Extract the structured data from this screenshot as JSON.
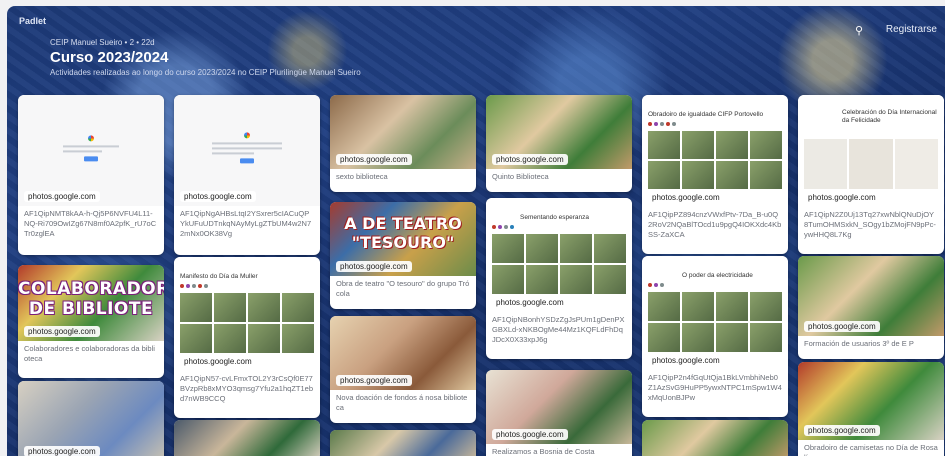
{
  "app": {
    "logo": "Padlet",
    "register_label": "Registrarse"
  },
  "header": {
    "meta": "CEIP Manuel Sueiro • 2 • 22d",
    "title": "Curso 2023/2024",
    "subtitle": "Actividades realizadas ao longo do curso 2023/2024 no CEIP Plurilingüe Manuel Sueiro"
  },
  "icons": {
    "search": "search-icon",
    "more": "more-vertical-icon"
  },
  "host": "photos.google.com",
  "cards": [
    {
      "caption": "AF1QipNMT8kAA-h-Qj5P6NVFU4L11-NQ-Ri709OwIZg67N8mf0A2pfK_rU7oCTr0zglEA"
    },
    {
      "caption": "Colaboradores e colaboradoras da biblioteca",
      "banner": "COLABORADORES/ DE BIBLIOTE"
    },
    {
      "caption": ""
    },
    {
      "caption": "AF1QipNgAHBsLtqI2YSxrer5cIACuQPYkUFuUDTnkqNAyMyLgZTbUM4w2N72mNx0OK38Vg"
    },
    {
      "caption": "AF1QipN57-cvLFmxTOL2Y3rCsQf0E77BVzpRb8xMYO3qmsg7Yfu2a1hqZT1ebd7nWB9CCQ",
      "album_title": "Manifesto do Día da Muller"
    },
    {
      "caption": ""
    },
    {
      "caption": "sexto biblioteca"
    },
    {
      "caption": "Obra de teatro \"O tesouro\" do grupo Trócola",
      "banner": "A DE TEATRO \"TESOURO\""
    },
    {
      "caption": "Nova doación de fondos á nosa biblioteca"
    },
    {
      "caption": ""
    },
    {
      "caption": "Quinto Biblioteca"
    },
    {
      "caption": "AF1QipNBonhYSDzZgJsPUm1gDenPXGBXLd-xNKBOgMe44Mz1KQFLdFhDqJDcX0X33xpJ6g",
      "album_title": "Sementando esperanza"
    },
    {
      "caption": "Realizamos a Bosnia de Costa"
    },
    {
      "caption": "AF1QipPZ894cnzVWxfPtv-7Da_B-u0Q2RoV2NQaBlTOcd1u9pgQ4IOKXdc4KbSS-ZaXCA",
      "album_title": "Obradoiro de igualdade CIFP Portovello"
    },
    {
      "caption": "AF1QipP2n4fGqUtQja1BkLVmbhiNeb0Z1AzSvG9HuPP5ywxNTPC1mSpw1W4xMqUonBJPw",
      "album_title": "O poder da electricidade"
    },
    {
      "caption": ""
    },
    {
      "caption": "AF1QipN2Z0Uj13Tq27xwNblQNuDjOY8TumOHMSxkN_SOgy1bZMojFN9pPc-ywHHQ8L7Kg",
      "album_title": "Celebración do Día Internacional da Felicidade"
    },
    {
      "caption": "Formación de usuarios 3º de E P"
    },
    {
      "caption": "Obradoiro de camisetas no Día de Rosalía"
    }
  ]
}
